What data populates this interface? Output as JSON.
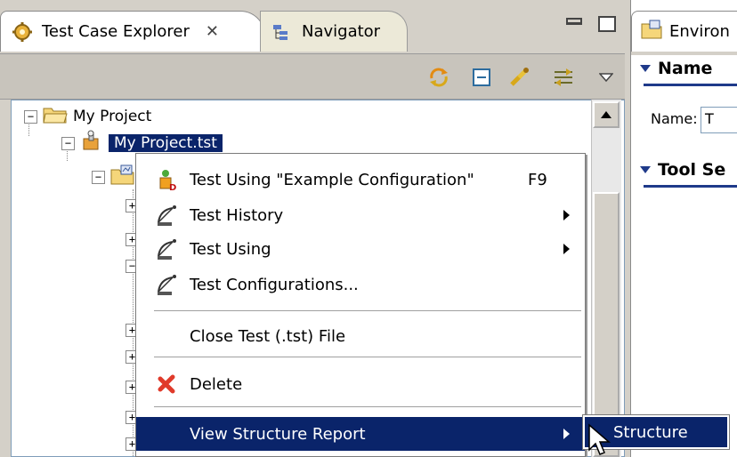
{
  "left_view": {
    "tabs": [
      {
        "label": "Test Case Explorer",
        "close_glyph": "✕",
        "icon": "gear-icon",
        "active": true
      },
      {
        "label": "Navigator",
        "icon": "navigator-icon",
        "active": false
      }
    ],
    "toolbar_icons": [
      "sync-icon",
      "collapse-all-icon",
      "link-editor-icon",
      "filter-icon",
      "view-menu-icon"
    ],
    "tree": {
      "root": {
        "label": "My Project",
        "icon": "folder-icon",
        "expander": "−"
      },
      "project_file": {
        "label": "My Project.tst",
        "icon": "test-file-icon",
        "expander": "−",
        "selected": true
      },
      "environment_node": {
        "icon": "environment-folder-icon",
        "expander": "−"
      },
      "child_expanders": [
        "+",
        "+",
        "−",
        "+",
        "+",
        "+",
        "+",
        "+"
      ]
    }
  },
  "right_view": {
    "tab_label": "Environ",
    "sections": [
      {
        "title": "Name"
      },
      {
        "title": "Tool Se"
      }
    ],
    "name_field": {
      "label": "Name:",
      "value": "T"
    }
  },
  "context_menu": {
    "items": [
      {
        "label": "Test Using \"Example Configuration\"",
        "shortcut": "F9",
        "icon": "run-test-icon",
        "submenu": false
      },
      {
        "label": "Test History",
        "icon": "satellite-icon",
        "submenu": true
      },
      {
        "label": "Test Using",
        "icon": "satellite-icon",
        "submenu": true
      },
      {
        "label": "Test Configurations...",
        "icon": "satellite-icon",
        "submenu": false
      },
      {
        "label": "Close Test (.tst) File",
        "submenu": false
      },
      {
        "label": "Delete",
        "icon": "delete-icon",
        "submenu": false
      },
      {
        "label": "View Structure Report",
        "submenu": true,
        "highlighted": true
      }
    ],
    "submenu": {
      "items": [
        {
          "label": "Structure",
          "highlighted": true
        }
      ]
    }
  },
  "colors": {
    "selection": "#0a246a",
    "section_accent": "#1f3a8a",
    "chrome": "#d4d0c8"
  }
}
